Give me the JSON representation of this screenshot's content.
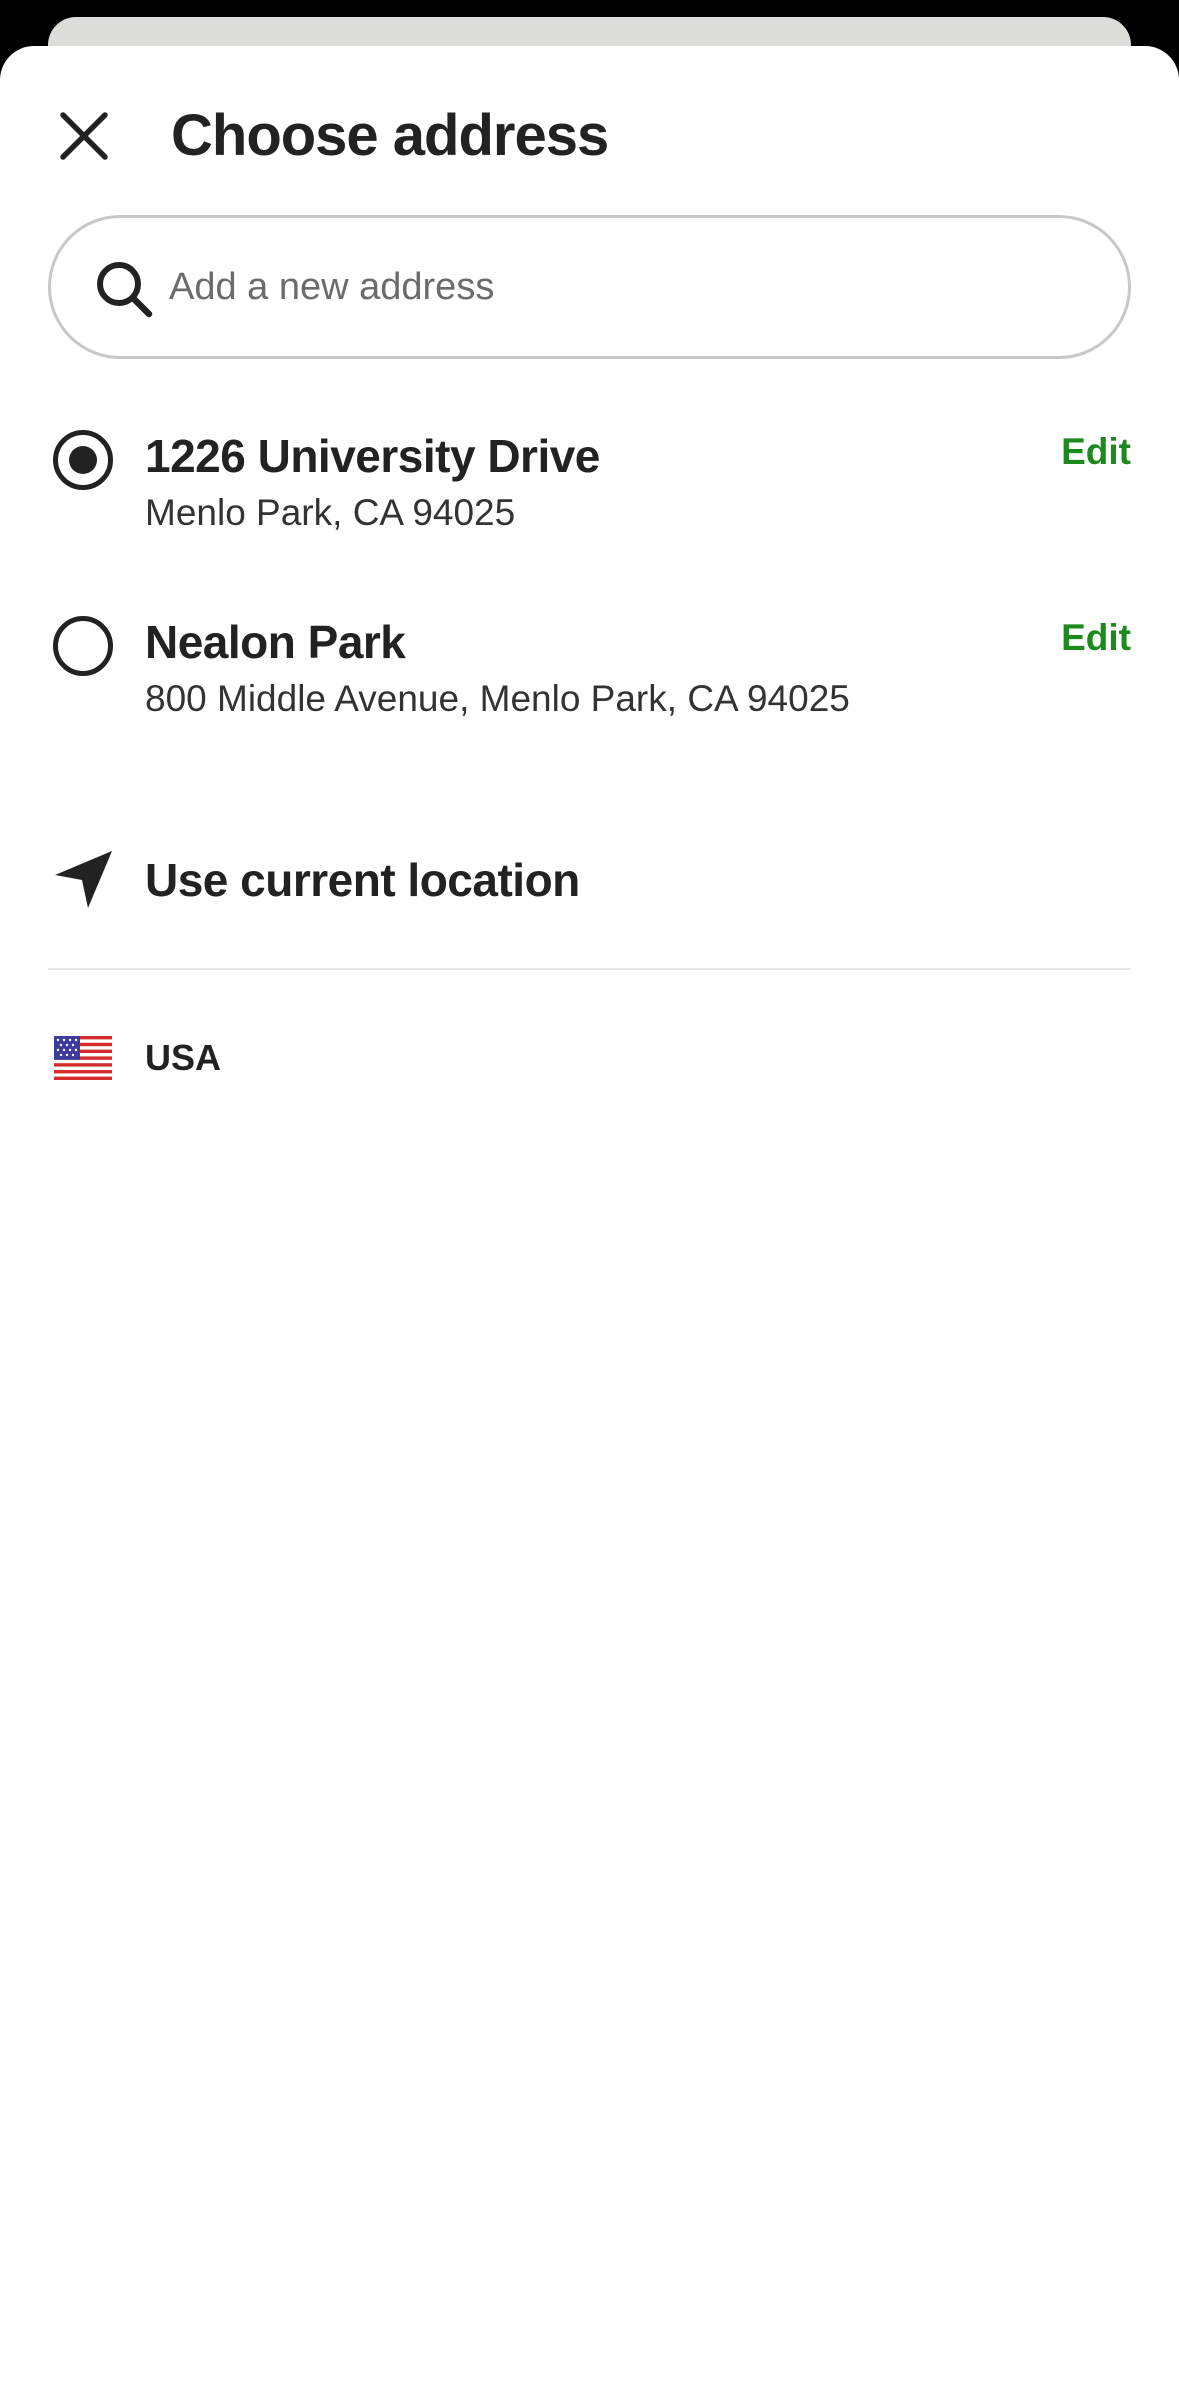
{
  "header": {
    "title": "Choose address",
    "close_icon": "close-icon"
  },
  "search": {
    "placeholder": "Add a new address",
    "icon": "search-icon"
  },
  "addresses": [
    {
      "name": "1226 University Drive",
      "detail": "Menlo Park, CA 94025",
      "selected": true,
      "edit_label": "Edit"
    },
    {
      "name": "Nealon Park",
      "detail": "800 Middle Avenue, Menlo Park, CA 94025",
      "selected": false,
      "edit_label": "Edit"
    }
  ],
  "current_location": {
    "label": "Use current location",
    "icon": "navigation-arrow-icon"
  },
  "country": {
    "label": "USA",
    "icon": "us-flag-icon"
  },
  "colors": {
    "accent_green": "#1c8a1c",
    "text_primary": "#222222",
    "border": "#c8c8c8"
  }
}
